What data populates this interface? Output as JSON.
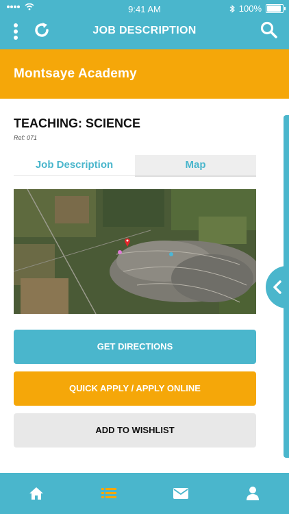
{
  "status_bar": {
    "time": "9:41 AM",
    "battery": "100%",
    "battery_level": 1.0
  },
  "header": {
    "title": "JOB DESCRIPTION",
    "icons": [
      "menu-dots-icon",
      "refresh-icon",
      "search-icon"
    ]
  },
  "banner": {
    "school": "Montsaye Academy"
  },
  "job": {
    "title": "TEACHING: SCIENCE",
    "ref": "Ref: 071"
  },
  "tabs": [
    {
      "label": "Job Description",
      "active": true
    },
    {
      "label": "Map",
      "active": false
    }
  ],
  "buttons": {
    "directions": "GET DIRECTIONS",
    "apply": "QUICK APPLY / APPLY ONLINE",
    "wishlist": "ADD TO WISHLIST"
  },
  "bottom_nav": [
    "home-icon",
    "list-icon",
    "mail-icon",
    "profile-icon"
  ],
  "colors": {
    "teal": "#4ab6cc",
    "orange": "#f5a709",
    "grey": "#e8e8e8"
  }
}
